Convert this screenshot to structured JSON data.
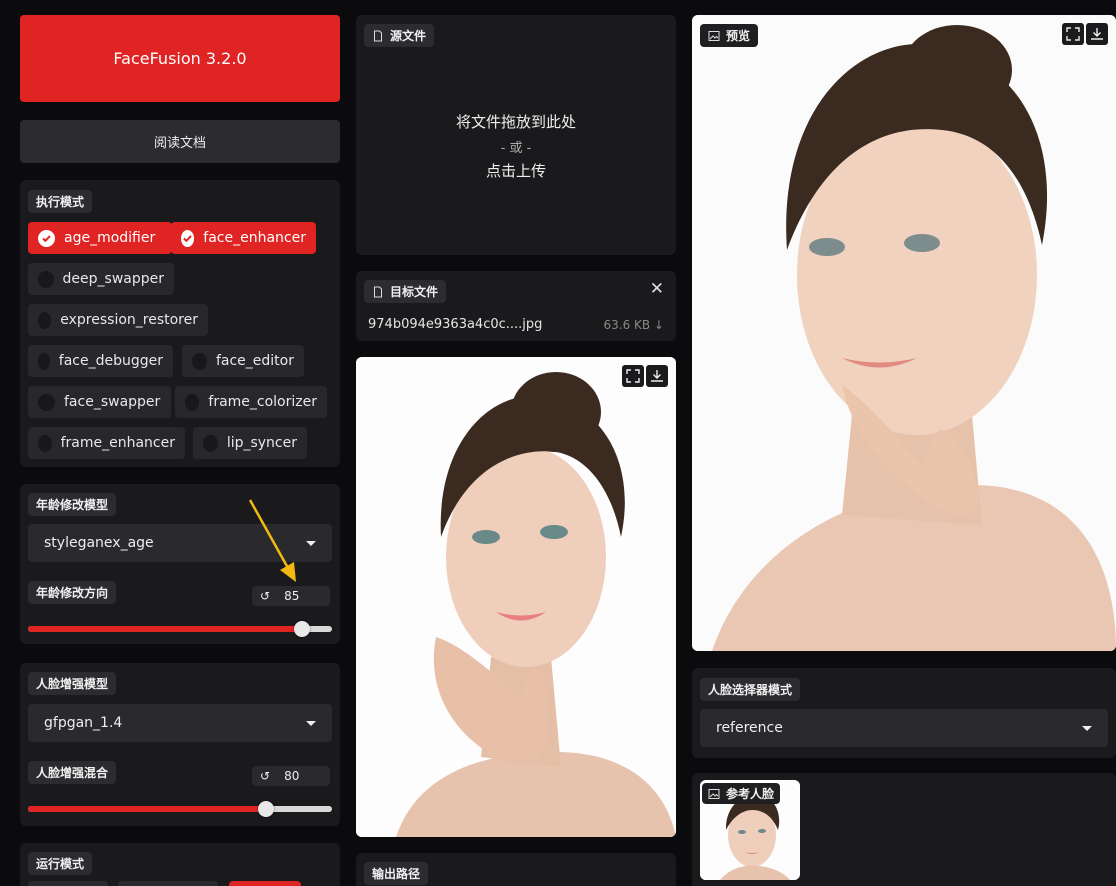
{
  "app": {
    "title_button": "FaceFusion 3.2.0",
    "docs_button": "阅读文档"
  },
  "execution_mode": {
    "label": "执行模式",
    "items": [
      {
        "label": "age_modifier",
        "checked": true
      },
      {
        "label": "face_enhancer",
        "checked": true
      },
      {
        "label": "deep_swapper",
        "checked": false
      },
      {
        "label": "expression_restorer",
        "checked": false
      },
      {
        "label": "face_debugger",
        "checked": false
      },
      {
        "label": "face_editor",
        "checked": false
      },
      {
        "label": "face_swapper",
        "checked": false
      },
      {
        "label": "frame_colorizer",
        "checked": false
      },
      {
        "label": "frame_enhancer",
        "checked": false
      },
      {
        "label": "lip_syncer",
        "checked": false
      }
    ]
  },
  "age_model": {
    "label": "年龄修改模型",
    "value": "styleganex_age"
  },
  "age_direction": {
    "label": "年龄修改方向",
    "value": "85",
    "fraction": 0.9
  },
  "enhancer_model": {
    "label": "人脸增强模型",
    "value": "gfpgan_1.4"
  },
  "enhancer_blend": {
    "label": "人脸增强混合",
    "value": "80",
    "fraction": 0.8
  },
  "run_mode": {
    "label": "运行模式"
  },
  "source": {
    "label": "源文件",
    "drop_text": "将文件拖放到此处",
    "or_text": "- 或 -",
    "click_text": "点击上传"
  },
  "target": {
    "label": "目标文件",
    "filename": "974b094e9363a4c0c....jpg",
    "size": "63.6 KB ↓"
  },
  "output": {
    "label": "输出路径"
  },
  "preview": {
    "label": "预览"
  },
  "face_selector": {
    "label": "人脸选择器模式",
    "value": "reference"
  },
  "reference_face": {
    "label": "参考人脸"
  },
  "colors": {
    "accent": "#e02424",
    "panel": "#1a1a1d",
    "background": "#0b0b0d"
  }
}
